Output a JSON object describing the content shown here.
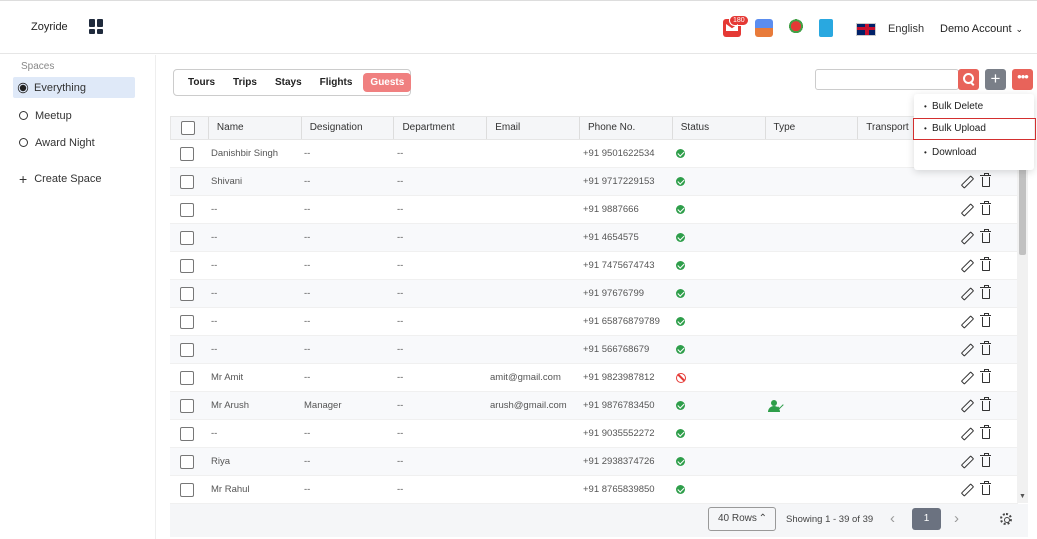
{
  "header": {
    "brand": "Zoyride",
    "notification_count": "180",
    "language": "English",
    "account": "Demo Account",
    "icons": [
      "mail-icon",
      "shop-icon",
      "map-pin-icon",
      "book-icon",
      "uk-flag-icon"
    ]
  },
  "sidebar": {
    "spaces_label": "Spaces",
    "items": [
      {
        "label": "Everything",
        "icon": "gear-icon",
        "active": true
      },
      {
        "label": "Meetup",
        "icon": "circle-icon"
      },
      {
        "label": "Award Night",
        "icon": "circle-icon"
      }
    ],
    "create_label": "Create Space"
  },
  "tabs": [
    {
      "label": "Tours"
    },
    {
      "label": "Trips"
    },
    {
      "label": "Stays"
    },
    {
      "label": "Flights"
    },
    {
      "label": "Guests",
      "active": true
    }
  ],
  "toolbar": {
    "search_placeholder": "",
    "add_label": "+",
    "more_label": "•••"
  },
  "dropdown": {
    "items": [
      "Bulk Delete",
      "Bulk Upload",
      "Download"
    ]
  },
  "table": {
    "columns": [
      "Name",
      "Designation",
      "Department",
      "Email",
      "Phone No.",
      "Status",
      "Type",
      "Transport"
    ],
    "rows": [
      {
        "name": "Danishbir Singh",
        "designation": "--",
        "department": "--",
        "email": "",
        "phone": "+91 9501622534",
        "status": "active",
        "type": ""
      },
      {
        "name": "Shivani",
        "designation": "--",
        "department": "--",
        "email": "",
        "phone": "+91 9717229153",
        "status": "active",
        "type": ""
      },
      {
        "name": "--",
        "designation": "--",
        "department": "--",
        "email": "",
        "phone": "+91 9887666",
        "status": "active",
        "type": ""
      },
      {
        "name": "--",
        "designation": "--",
        "department": "--",
        "email": "",
        "phone": "+91 4654575",
        "status": "active",
        "type": ""
      },
      {
        "name": "--",
        "designation": "--",
        "department": "--",
        "email": "",
        "phone": "+91 7475674743",
        "status": "active",
        "type": ""
      },
      {
        "name": "--",
        "designation": "--",
        "department": "--",
        "email": "",
        "phone": "+91 97676799",
        "status": "active",
        "type": ""
      },
      {
        "name": "--",
        "designation": "--",
        "department": "--",
        "email": "",
        "phone": "+91 65876879789",
        "status": "active",
        "type": ""
      },
      {
        "name": "--",
        "designation": "--",
        "department": "--",
        "email": "",
        "phone": "+91 566768679",
        "status": "active",
        "type": ""
      },
      {
        "name": "Mr Amit",
        "designation": "--",
        "department": "--",
        "email": "amit@gmail.com",
        "phone": "+91 9823987812",
        "status": "blocked",
        "type": ""
      },
      {
        "name": "Mr Arush",
        "designation": "Manager",
        "department": "--",
        "email": "arush@gmail.com",
        "phone": "+91 9876783450",
        "status": "active",
        "type": "user-check"
      },
      {
        "name": "--",
        "designation": "--",
        "department": "--",
        "email": "",
        "phone": "+91 9035552272",
        "status": "active",
        "type": ""
      },
      {
        "name": "Riya",
        "designation": "--",
        "department": "--",
        "email": "",
        "phone": "+91 2938374726",
        "status": "active",
        "type": ""
      },
      {
        "name": "Mr Rahul",
        "designation": "--",
        "department": "--",
        "email": "",
        "phone": "+91 8765839850",
        "status": "active",
        "type": ""
      }
    ]
  },
  "footer": {
    "rows_label": "40 Rows",
    "showing": "Showing  1 - 39 of 39",
    "current_page": "1"
  }
}
